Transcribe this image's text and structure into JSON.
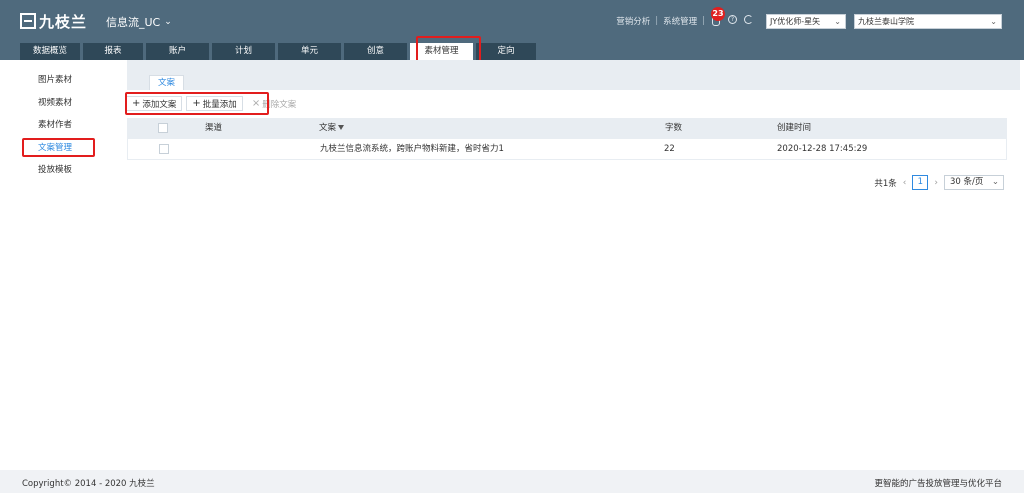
{
  "header": {
    "logo_text": "九枝兰",
    "product": "信息流_UC",
    "links": [
      "营销分析",
      "系统管理"
    ],
    "notification_count": "23",
    "account_select": "JY优化师-星矢",
    "school_select": "九枝兰泰山学院"
  },
  "nav": {
    "tabs": [
      {
        "label": "数据概览"
      },
      {
        "label": "报表"
      },
      {
        "label": "账户"
      },
      {
        "label": "计划"
      },
      {
        "label": "单元"
      },
      {
        "label": "创意"
      },
      {
        "label": "素材管理"
      },
      {
        "label": "定向"
      }
    ],
    "active_index": 6
  },
  "sidebar": {
    "items": [
      {
        "label": "图片素材"
      },
      {
        "label": "视频素材"
      },
      {
        "label": "素材作者"
      },
      {
        "label": "文案管理"
      },
      {
        "label": "投放模板"
      }
    ],
    "active_index": 3
  },
  "content": {
    "tab_label": "文案",
    "toolbar": {
      "add_label": "添加文案",
      "batch_add_label": "批量添加",
      "delete_label": "删除文案"
    },
    "table": {
      "columns": [
        "渠道",
        "文案",
        "字数",
        "创建时间"
      ],
      "rows": [
        {
          "channel": "",
          "text": "九枝兰信息流系统，跨账户物料新建，省时省力1",
          "count": "22",
          "created": "2020-12-28 17:45:29"
        }
      ]
    },
    "pager": {
      "total": "共1条",
      "current": "1",
      "page_size": "30 条/页"
    }
  },
  "footer": {
    "copyright": "Copyright© 2014 - 2020 九枝兰",
    "slogan": "更智能的广告投放管理与优化平台"
  },
  "colors": {
    "header_bg": "#4f6a7d",
    "nav_bg": "#2f4858",
    "accent": "#2f8ae0",
    "highlight": "#e21d1d"
  }
}
